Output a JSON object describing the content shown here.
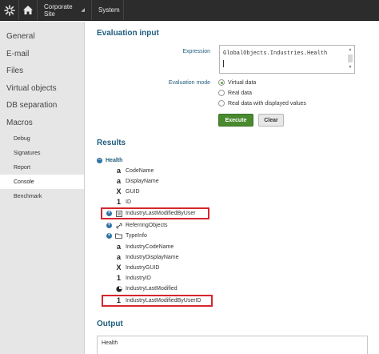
{
  "topbar": {
    "logo_icon": "kentico-logo-icon",
    "home_icon": "home-icon",
    "site_label": "Corporate Site",
    "system_label": "System"
  },
  "sidebar": {
    "items": [
      {
        "label": "General"
      },
      {
        "label": "E-mail"
      },
      {
        "label": "Files"
      },
      {
        "label": "Virtual objects"
      },
      {
        "label": "DB separation"
      },
      {
        "label": "Macros"
      }
    ],
    "subitems": [
      {
        "label": "Debug"
      },
      {
        "label": "Signatures"
      },
      {
        "label": "Report"
      },
      {
        "label": "Console",
        "active": true
      },
      {
        "label": "Benchmark"
      }
    ]
  },
  "evaluation": {
    "title": "Evaluation input",
    "expression_label": "Expression",
    "expression_value": "GlobalObjects.Industries.Health",
    "mode_label": "Evaluation mode",
    "modes": [
      {
        "label": "Virtual data",
        "checked": true
      },
      {
        "label": "Real data",
        "checked": false
      },
      {
        "label": "Real data with displayed values",
        "checked": false
      }
    ],
    "execute_label": "Execute",
    "clear_label": "Clear"
  },
  "results": {
    "title": "Results",
    "root": "Health",
    "items": [
      {
        "label": "CodeName",
        "icon": "string-icon"
      },
      {
        "label": "DisplayName",
        "icon": "string-icon"
      },
      {
        "label": "GUID",
        "icon": "guid-icon"
      },
      {
        "label": "ID",
        "icon": "integer-icon"
      },
      {
        "label": "IndustryLastModifiedByUser",
        "icon": "object-icon",
        "expandable": true,
        "highlighted": true
      },
      {
        "label": "ReferringObjects",
        "icon": "link-icon",
        "expandable": true
      },
      {
        "label": "TypeInfo",
        "icon": "folder-icon",
        "expandable": true
      },
      {
        "label": "IndustryCodeName",
        "icon": "string-icon"
      },
      {
        "label": "IndustryDisplayName",
        "icon": "string-icon"
      },
      {
        "label": "IndustryGUID",
        "icon": "guid-icon"
      },
      {
        "label": "IndustryID",
        "icon": "integer-icon"
      },
      {
        "label": "IndustryLastModified",
        "icon": "datetime-icon"
      },
      {
        "label": "IndustryLastModifiedByUserID",
        "icon": "integer-icon",
        "highlighted": true
      }
    ],
    "glyphs": {
      "string": "a",
      "guid": "X",
      "integer": "1"
    }
  },
  "output": {
    "title": "Output",
    "value": "Health"
  },
  "colors": {
    "accent": "#1f5d7d",
    "highlight": "#d6262e",
    "execute": "#498a2e"
  }
}
